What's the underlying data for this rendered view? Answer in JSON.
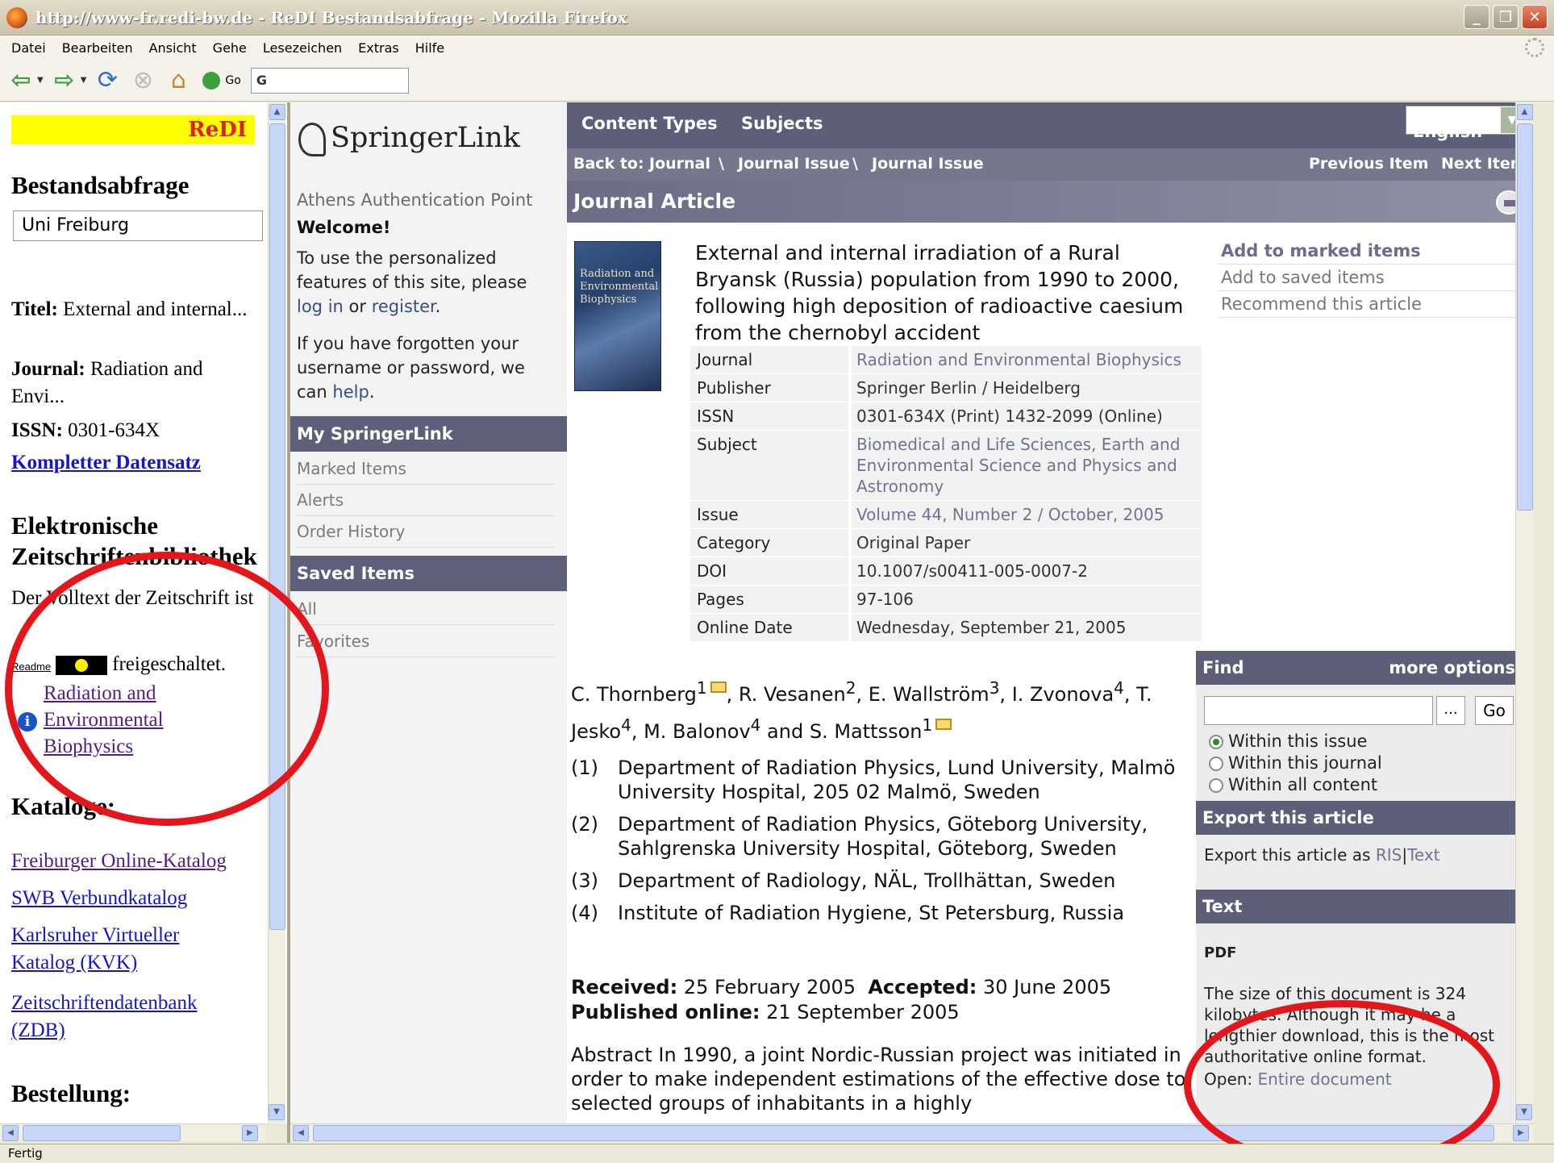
{
  "window": {
    "title": "http://www-fr.redi-bw.de - ReDI Bestandsabfrage - Mozilla Firefox",
    "buttons": {
      "minimize": "_",
      "maximize": "❐",
      "close": "✕"
    }
  },
  "menu": [
    "Datei",
    "Bearbeiten",
    "Ansicht",
    "Gehe",
    "Lesezeichen",
    "Extras",
    "Hilfe"
  ],
  "toolbar": {
    "go_label": "Go",
    "url_value": "G"
  },
  "redi": {
    "banner": "ReDI",
    "heading": "Bestandsabfrage",
    "institution_select": "Uni Freiburg",
    "titel_label": "Titel:",
    "titel_value": "External and internal...",
    "journal_label": "Journal:",
    "journal_value": "Radiation and Envi...",
    "issn_label": "ISSN:",
    "issn_value": "0301-634X",
    "full_record_link": "Kompletter Datensatz",
    "ezb_heading": "Elektronische Zeitschriftenbibliothek",
    "ezb_text_1": "Der Volltext der Zeitschrift ist",
    "readme": "Readme",
    "ezb_text_2": "freigeschaltet.",
    "ezb_link": "Radiation and Environmental Biophysics",
    "kataloge_heading": "Kataloge:",
    "catalog_links": [
      "Freiburger Online-Katalog",
      "SWB Verbundkatalog",
      "Karlsruher Virtueller Katalog (KVK)",
      "Zeitschriftendatenbank (ZDB)"
    ],
    "bestellung_heading": "Bestellung:"
  },
  "springer": {
    "logo": "SpringerLink",
    "athens": "Athens Authentication Point",
    "welcome": "Welcome!",
    "intro_1": "To use the personalized features of this site, please",
    "login": "log in",
    "or": "or",
    "register": "register",
    "forgot_1": "If you have forgotten your username or password, we can",
    "help": "help",
    "my_springerlink": "My SpringerLink",
    "my_items": [
      "Marked Items",
      "Alerts",
      "Order History"
    ],
    "saved_items": "Saved Items",
    "saved_list": [
      "All",
      "Favorites"
    ],
    "nav": {
      "content_types": "Content Types",
      "subjects": "Subjects",
      "language": "English"
    },
    "breadcrumb": {
      "back_to": "Back to:",
      "items": [
        "Journal",
        "Journal Issue",
        "Journal Issue"
      ],
      "sep": "\\",
      "previous": "Previous Item",
      "next": "Next Item"
    },
    "article_header": "Journal Article",
    "cover_text": "Radiation and Environmental Biophysics",
    "title": "External and internal irradiation of a Rural Bryansk (Russia) population from 1990 to 2000, following high deposition of radioactive caesium from the chernobyl accident",
    "meta": [
      {
        "k": "Journal",
        "v": "Radiation and Environmental Biophysics",
        "link": true
      },
      {
        "k": "Publisher",
        "v": "Springer Berlin / Heidelberg",
        "link": false
      },
      {
        "k": "ISSN",
        "v": "0301-634X (Print) 1432-2099 (Online)",
        "link": false
      },
      {
        "k": "Subject",
        "v": "Biomedical and Life Sciences, Earth and Environmental Science and Physics and Astronomy",
        "link": true
      },
      {
        "k": "Issue",
        "v": "Volume 44, Number 2 / October, 2005",
        "link": true
      },
      {
        "k": "Category",
        "v": "Original Paper",
        "link": false
      },
      {
        "k": "DOI",
        "v": "10.1007/s00411-005-0007-2",
        "link": false
      },
      {
        "k": "Pages",
        "v": "97-106",
        "link": false
      },
      {
        "k": "Online Date",
        "v": "Wednesday, September 21, 2005",
        "link": false
      }
    ],
    "actions": [
      "Add to marked items",
      "Add to saved items",
      "Recommend this article"
    ],
    "authors_line1": "C. Thornberg",
    "authors": [
      {
        "name": "C. Thornberg",
        "sup": "1",
        "mail": true
      },
      {
        "name": "R. Vesanen",
        "sup": "2",
        "mail": false
      },
      {
        "name": "E. Wallström",
        "sup": "3",
        "mail": false
      },
      {
        "name": "I. Zvonova",
        "sup": "4",
        "mail": false
      },
      {
        "name": "T. Jesko",
        "sup": "4",
        "mail": false
      },
      {
        "name": "M. Balonov",
        "sup": "4",
        "mail": false
      },
      {
        "name": "S. Mattsson",
        "sup": "1",
        "mail": true
      }
    ],
    "and": "and",
    "affiliations": [
      {
        "n": "(1)",
        "t": "Department of Radiation Physics, Lund University, Malmö University Hospital, 205 02 Malmö, Sweden"
      },
      {
        "n": "(2)",
        "t": "Department of Radiation Physics, Göteborg University, Sahlgrenska University Hospital, Göteborg, Sweden"
      },
      {
        "n": "(3)",
        "t": "Department of Radiology, NÄL, Trollhättan, Sweden"
      },
      {
        "n": "(4)",
        "t": "Institute of Radiation Hygiene, St Petersburg, Russia"
      }
    ],
    "dates": {
      "received_label": "Received:",
      "received": "25 February 2005",
      "accepted_label": "Accepted:",
      "accepted": "30 June 2005",
      "published_label": "Published online:",
      "published": "21 September 2005"
    },
    "abstract": "Abstract  In 1990, a joint Nordic-Russian project was initiated in order to make independent estimations of the effective dose to selected groups of inhabitants in a highly",
    "find": {
      "heading": "Find",
      "more": "more options",
      "dots": "...",
      "go": "Go",
      "options": [
        "Within this issue",
        "Within this journal",
        "Within all content"
      ],
      "selected_index": 0
    },
    "export": {
      "heading": "Export this article",
      "text": "Export this article as",
      "ris": "RIS",
      "sep": "|",
      "txt": "Text"
    },
    "text_box": {
      "heading": "Text",
      "pdf": "PDF",
      "size_note": "The size of this document is 324 kilobytes. Although it may be a lengthier download, this is the most authoritative online format.",
      "open_label": "Open:",
      "open_link": "Entire document"
    }
  },
  "status": "Fertig",
  "annotation_color": "#e3161b"
}
